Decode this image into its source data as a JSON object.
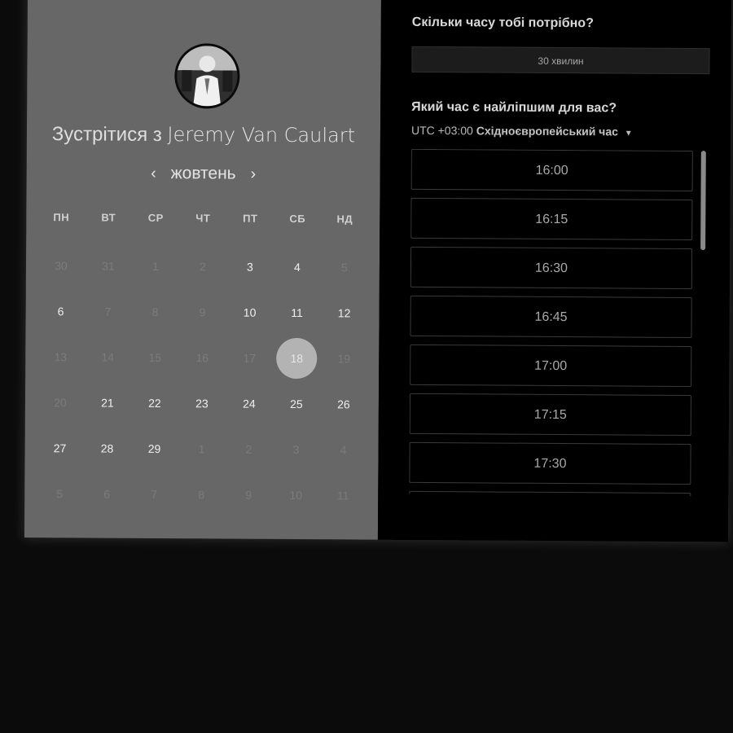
{
  "host": {
    "title_prefix": "Зустрітися з",
    "name": "Jeremy Van Caulart"
  },
  "calendar": {
    "month": "жовтень",
    "prev_icon": "‹",
    "next_icon": "›",
    "weekdays": [
      "ПН",
      "ВТ",
      "СР",
      "ЧТ",
      "ПТ",
      "СБ",
      "НД"
    ],
    "days": [
      {
        "n": "30",
        "state": "muted"
      },
      {
        "n": "31",
        "state": "muted"
      },
      {
        "n": "1",
        "state": "muted"
      },
      {
        "n": "2",
        "state": "muted"
      },
      {
        "n": "3",
        "state": "available"
      },
      {
        "n": "4",
        "state": "available"
      },
      {
        "n": "5",
        "state": "muted"
      },
      {
        "n": "6",
        "state": "available"
      },
      {
        "n": "7",
        "state": "muted"
      },
      {
        "n": "8",
        "state": "muted"
      },
      {
        "n": "9",
        "state": "muted"
      },
      {
        "n": "10",
        "state": "available"
      },
      {
        "n": "11",
        "state": "available"
      },
      {
        "n": "12",
        "state": "available"
      },
      {
        "n": "13",
        "state": "muted"
      },
      {
        "n": "14",
        "state": "muted"
      },
      {
        "n": "15",
        "state": "muted"
      },
      {
        "n": "16",
        "state": "muted"
      },
      {
        "n": "17",
        "state": "muted"
      },
      {
        "n": "18",
        "state": "selected"
      },
      {
        "n": "19",
        "state": "muted"
      },
      {
        "n": "20",
        "state": "muted"
      },
      {
        "n": "21",
        "state": "available"
      },
      {
        "n": "22",
        "state": "available"
      },
      {
        "n": "23",
        "state": "available"
      },
      {
        "n": "24",
        "state": "available"
      },
      {
        "n": "25",
        "state": "available"
      },
      {
        "n": "26",
        "state": "available"
      },
      {
        "n": "27",
        "state": "available"
      },
      {
        "n": "28",
        "state": "available"
      },
      {
        "n": "29",
        "state": "available"
      },
      {
        "n": "1",
        "state": "muted"
      },
      {
        "n": "2",
        "state": "muted"
      },
      {
        "n": "3",
        "state": "muted"
      },
      {
        "n": "4",
        "state": "muted"
      },
      {
        "n": "5",
        "state": "muted"
      },
      {
        "n": "6",
        "state": "muted"
      },
      {
        "n": "7",
        "state": "muted"
      },
      {
        "n": "8",
        "state": "muted"
      },
      {
        "n": "9",
        "state": "muted"
      },
      {
        "n": "10",
        "state": "muted"
      },
      {
        "n": "11",
        "state": "muted"
      }
    ]
  },
  "booking": {
    "duration_question": "Скільки часу тобі потрібно?",
    "duration_value": "30 хвилин",
    "time_question": "Який час є найліпшим для вас?",
    "timezone_offset": "UTC +03:00",
    "timezone_name": "Східноєвропейський час",
    "timezone_caret": "▼",
    "slots": [
      "16:00",
      "16:15",
      "16:30",
      "16:45",
      "17:00",
      "17:15",
      "17:30",
      ""
    ]
  },
  "colors": {
    "left_panel": "#676767",
    "right_panel": "#000000",
    "selected_day": "#b3b3b3"
  }
}
